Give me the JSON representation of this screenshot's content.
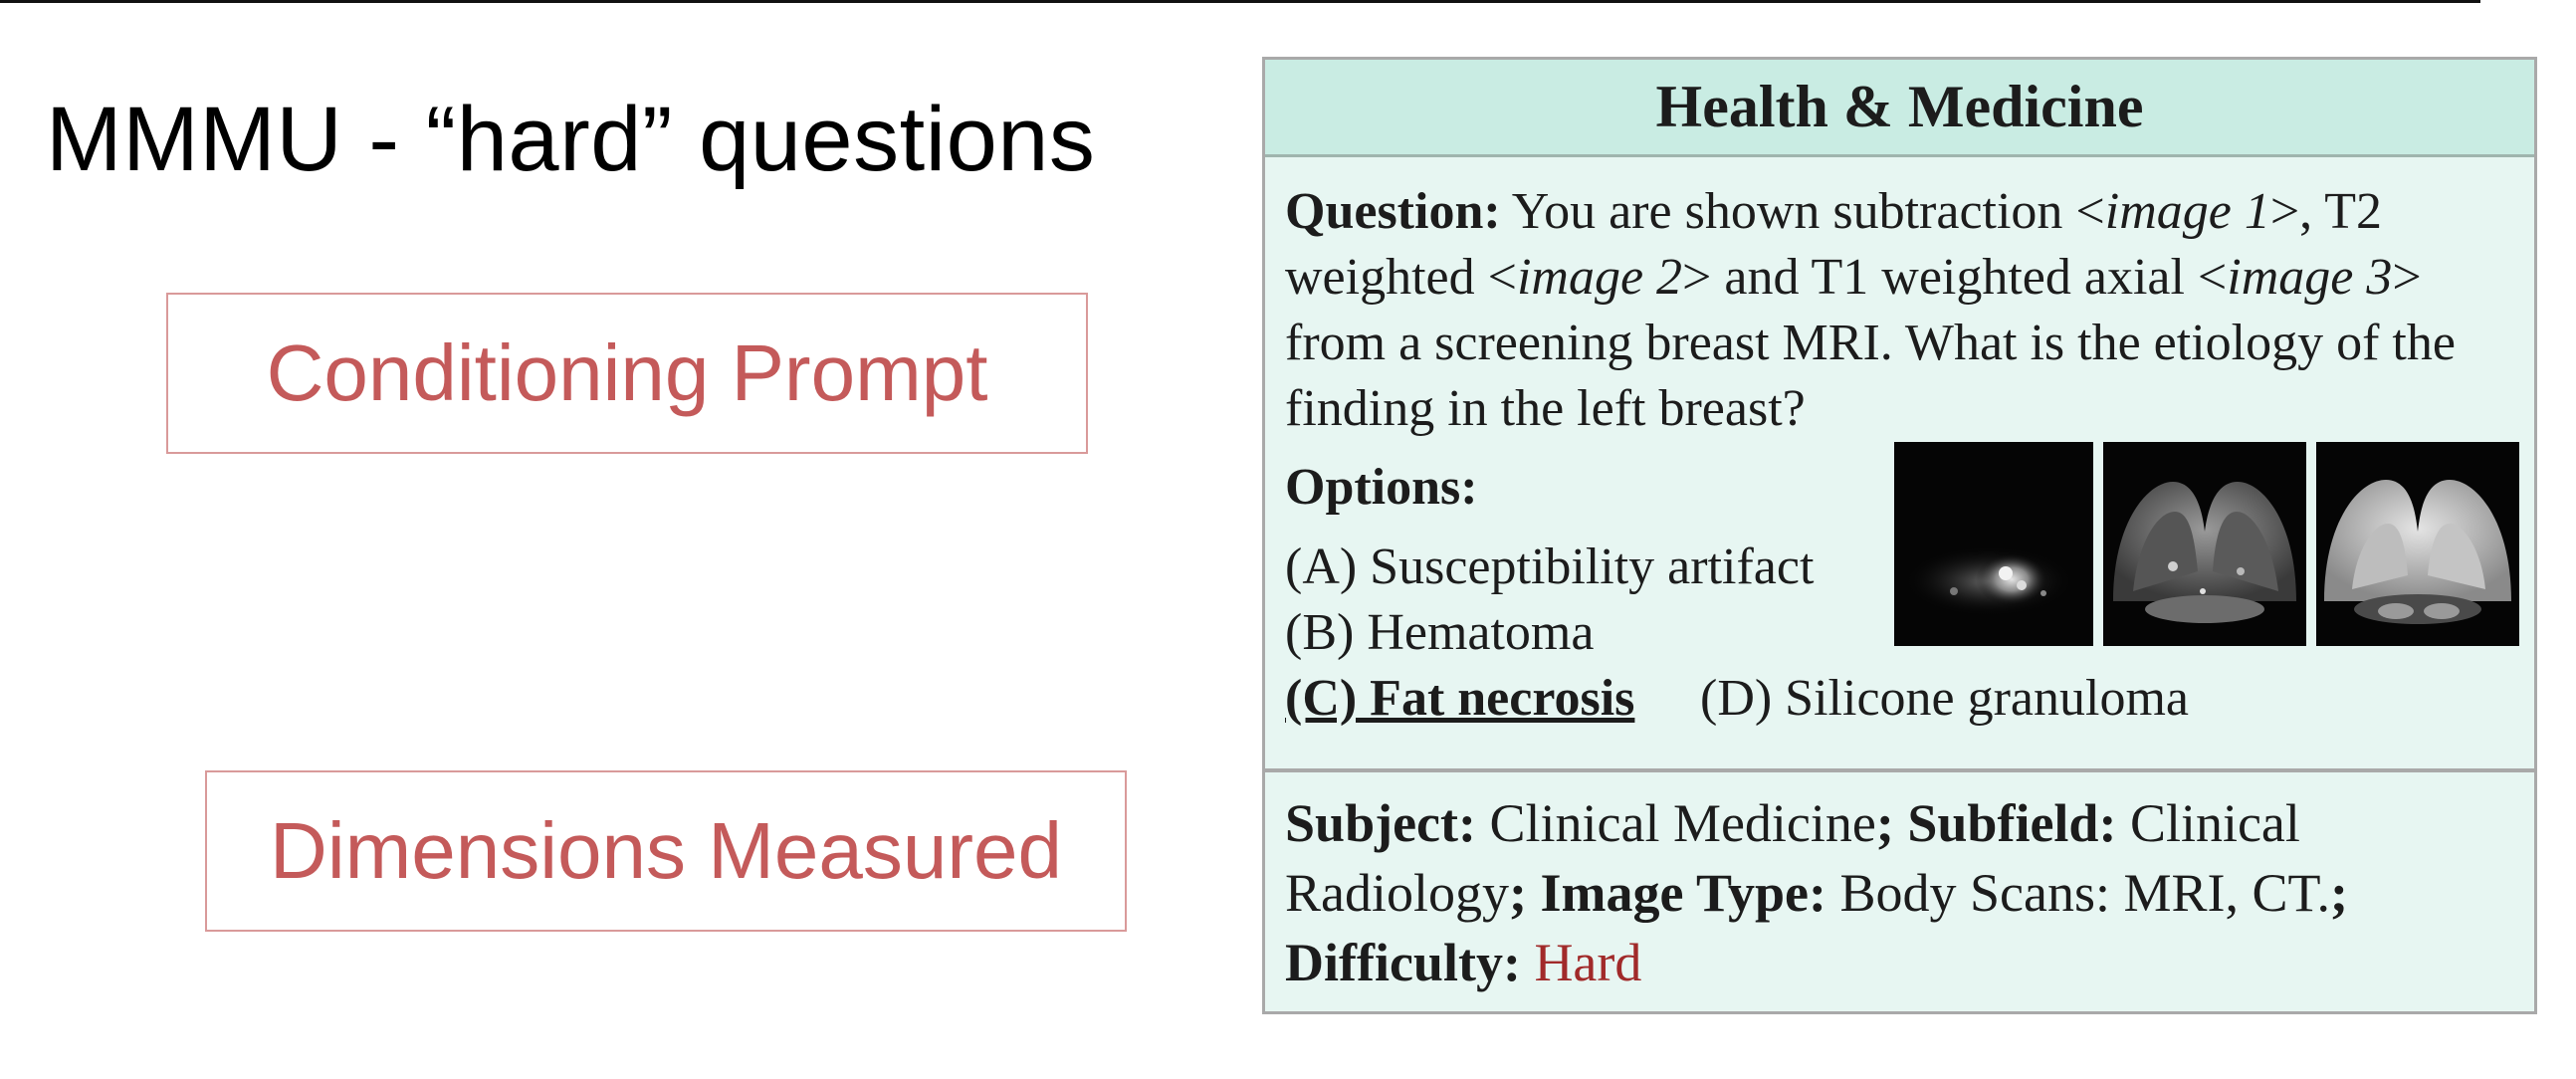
{
  "slide": {
    "title": "MMMU - “hard” questions",
    "boxes": {
      "conditioning": "Conditioning Prompt",
      "dimensions": "Dimensions Measured"
    },
    "box_text_color": "#c45a5a"
  },
  "card": {
    "header": "Health & Medicine",
    "question_label": "Question:",
    "question_parts": {
      "p1": " You are shown subtraction <",
      "img1": "image 1",
      "p2": ">, T2 weighted <",
      "img2": "image 2",
      "p3": "> and T1 weighted axial <",
      "img3": "image 3",
      "p4": "> from a screening breast MRI. What is the etiology of the finding in the left breast?"
    },
    "options_label": "Options:",
    "options": {
      "a": "(A) Susceptibility artifact",
      "b": "(B) Hematoma",
      "c": "(C) Fat necrosis",
      "d": "(D) Silicone granuloma"
    },
    "meta": {
      "subject_label": "Subject:",
      "subject": " Clinical Medicine",
      "sep1": "; ",
      "subfield_label": "Subfield:",
      "subfield": " Clinical Radiology",
      "sep2": "; ",
      "image_type_label": "Image Type:",
      "image_type": " Body Scans: MRI, CT.",
      "sep3": ";",
      "difficulty_label": "Difficulty:",
      "difficulty": " Hard"
    },
    "header_bg": "#c9ece3",
    "body_bg": "#e7f6f2",
    "difficulty_color": "#a12a2a"
  }
}
